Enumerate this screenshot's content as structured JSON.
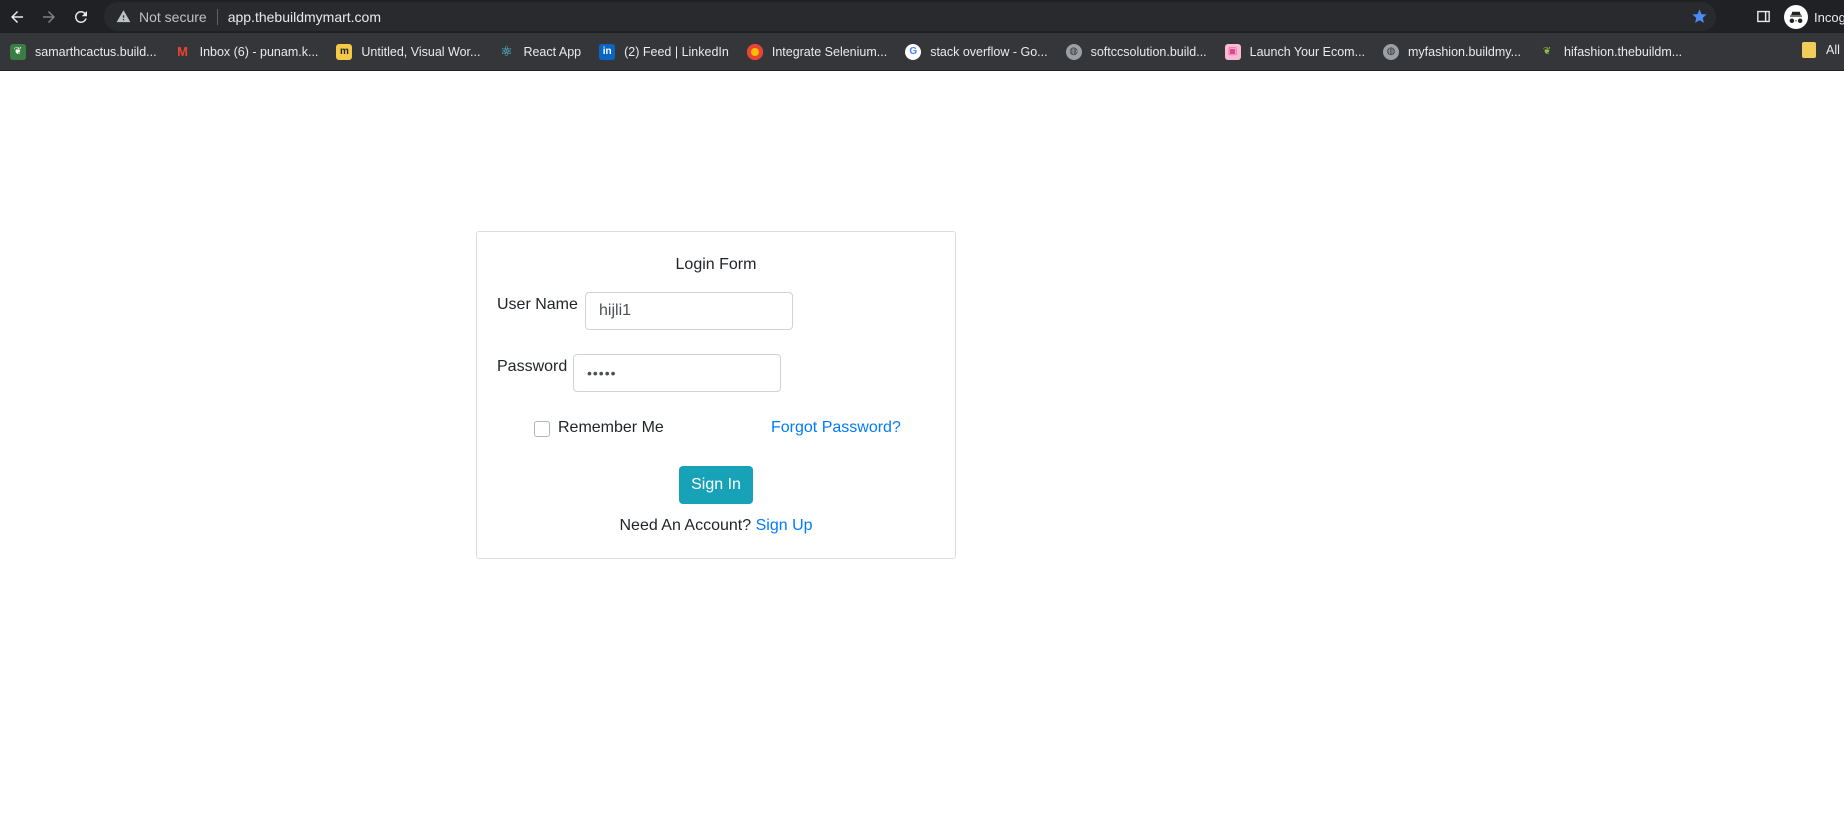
{
  "browser": {
    "security_text": "Not secure",
    "url": "app.thebuildmymart.com",
    "profile_label": "Incog",
    "bookmarks": [
      {
        "label": "samarthcactus.build...",
        "icon": "leaf-favicon",
        "color": "#3a7d44"
      },
      {
        "label": "Inbox (6) - punam.k...",
        "icon": "gmail-favicon",
        "color": "#ea4335"
      },
      {
        "label": "Untitled, Visual Wor...",
        "icon": "miro-favicon",
        "color": "#f7c948"
      },
      {
        "label": "React App",
        "icon": "react-favicon",
        "color": "#61dafb"
      },
      {
        "label": "(2) Feed | LinkedIn",
        "icon": "linkedin-favicon",
        "color": "#0a66c2"
      },
      {
        "label": "Integrate Selenium...",
        "icon": "chrome-favicon",
        "color": "#fbbc05"
      },
      {
        "label": "stack overflow - Go...",
        "icon": "google-favicon",
        "color": "#4285f4"
      },
      {
        "label": "softccsolution.build...",
        "icon": "globe-favicon",
        "color": "#9aa0a6"
      },
      {
        "label": "Launch Your Ecom...",
        "icon": "shop-favicon",
        "color": "#e84393"
      },
      {
        "label": "myfashion.buildmy...",
        "icon": "globe-favicon",
        "color": "#9aa0a6"
      },
      {
        "label": "hifashion.thebuildm...",
        "icon": "leaf-favicon",
        "color": "#8bc34a"
      }
    ],
    "all_bookmarks_label": "All"
  },
  "login": {
    "title": "Login Form",
    "username_label": "User Name",
    "username_value": "hijli1",
    "password_label": "Password",
    "password_value": "•••••",
    "remember_label": "Remember Me",
    "remember_checked": false,
    "forgot_label": "Forgot Password?",
    "signin_label": "Sign In",
    "account_prompt": "Need An Account?",
    "signup_label": "Sign Up"
  },
  "colors": {
    "primary_button": "#17a2b8",
    "link": "#007bff"
  }
}
